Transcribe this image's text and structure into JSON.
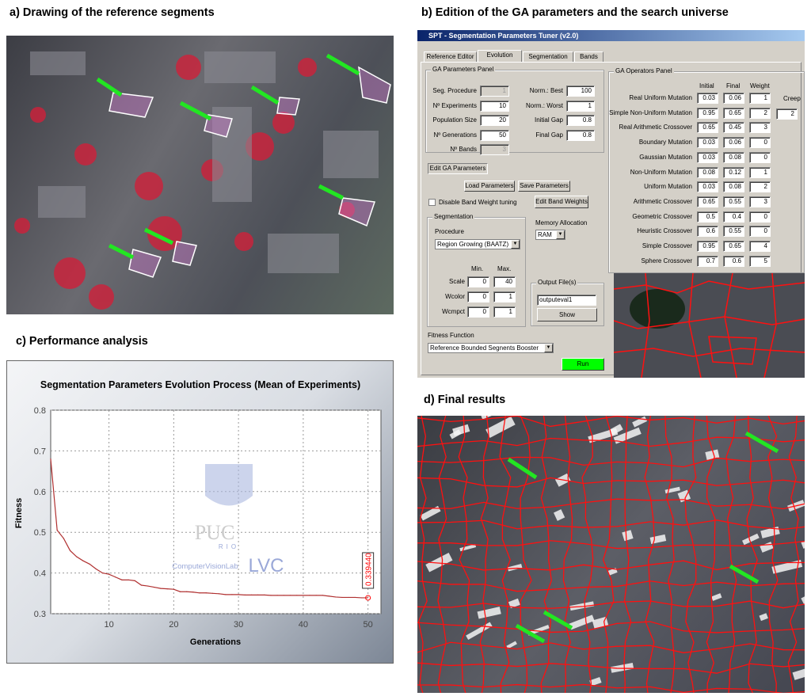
{
  "captions": {
    "a": "a) Drawing of the reference segments",
    "b": "b) Edition of the GA parameters and the search universe",
    "c": "c) Performance analysis",
    "d": "d) Final results"
  },
  "window": {
    "title": "SPT - Segmentation Parameters Tuner (v2.0)",
    "tabs": [
      "Reference Editor",
      "Evolution",
      "Segmentation",
      "Bands"
    ],
    "active_tab": "Evolution",
    "ga_params": {
      "title": "GA Parameters Panel",
      "left": [
        {
          "label": "Seg. Procedure",
          "value": "1",
          "disabled": true
        },
        {
          "label": "Nº Experiments",
          "value": "10"
        },
        {
          "label": "Population Size",
          "value": "20"
        },
        {
          "label": "Nº Generations",
          "value": "50"
        },
        {
          "label": "Nº Bands",
          "value": "3",
          "disabled": true
        }
      ],
      "right": [
        {
          "label": "Norm.: Best",
          "value": "100"
        },
        {
          "label": "Norm.: Worst",
          "value": "1"
        },
        {
          "label": "Initial Gap",
          "value": "0.8"
        },
        {
          "label": "Final Gap",
          "value": "0.8"
        }
      ]
    },
    "ga_ops": {
      "title": "GA Operators Panel",
      "headers": [
        "Initial",
        "Final",
        "Weight"
      ],
      "creep_label": "Creep",
      "creep_value": "2",
      "rows": [
        [
          "Real Uniform Mutation",
          "0.03",
          "0.06",
          "1"
        ],
        [
          "Simple Non-Uniform Mutation",
          "0.95",
          "0.65",
          "2"
        ],
        [
          "Real Arithmetic Crossover",
          "0.65",
          "0.45",
          "3"
        ],
        [
          "Boundary Mutation",
          "0.03",
          "0.06",
          "0"
        ],
        [
          "Gaussian Mutation",
          "0.03",
          "0.08",
          "0"
        ],
        [
          "Non-Uniform Mutation",
          "0.08",
          "0.12",
          "1"
        ],
        [
          "Uniform Mutation",
          "0.03",
          "0.08",
          "2"
        ],
        [
          "Arithmetic Crossover",
          "0.65",
          "0.55",
          "3"
        ],
        [
          "Geometric Crossover",
          "0.5",
          "0.4",
          "0"
        ],
        [
          "Heuristic Crossover",
          "0.6",
          "0.55",
          "0"
        ],
        [
          "Simple Crossover",
          "0.95",
          "0.65",
          "4"
        ],
        [
          "Sphere Crossover",
          "0.7",
          "0.6",
          "5"
        ]
      ]
    },
    "edit_ga": "Edit GA Parameters",
    "load": "Load Parameters",
    "save": "Save Parameters",
    "disable_band": "Disable Band Weight tuning",
    "edit_band": "Edit Band Weights",
    "segmentation": {
      "title": "Segmentation",
      "procedure_label": "Procedure",
      "procedure": "Region Growing (BAATZ)",
      "min": "Min.",
      "max": "Max.",
      "rows": [
        [
          "Scale",
          "0",
          "40"
        ],
        [
          "Wcolor",
          "0",
          "1"
        ],
        [
          "Wcmpct",
          "0",
          "1"
        ]
      ]
    },
    "memory_label": "Memory Allocation",
    "memory": "RAM",
    "output": {
      "title": "Output File(s)",
      "value": "outputeval1",
      "show": "Show"
    },
    "fitness_label": "Fitness Function",
    "fitness": "Reference Bounded Segnents Booster",
    "run": "Run",
    "run_color": "#00ff00"
  },
  "chart_data": {
    "type": "line",
    "title": "Segmentation Parameters Evolution Process (Mean of Experiments)",
    "xlabel": "Generations",
    "ylabel": "Fitness",
    "xlim": [
      1,
      52
    ],
    "ylim": [
      0.3,
      0.8
    ],
    "xticks": [
      10,
      20,
      30,
      40,
      50
    ],
    "yticks": [
      0.3,
      0.4,
      0.5,
      0.6,
      0.7,
      0.8
    ],
    "grid": true,
    "x": [
      1,
      2,
      3,
      4,
      5,
      6,
      7,
      8,
      9,
      10,
      11,
      12,
      13,
      14,
      15,
      16,
      17,
      18,
      19,
      20,
      21,
      22,
      23,
      24,
      25,
      26,
      27,
      28,
      29,
      30,
      31,
      32,
      33,
      34,
      35,
      36,
      37,
      38,
      39,
      40,
      41,
      42,
      43,
      44,
      45,
      46,
      47,
      48,
      49,
      50
    ],
    "y": [
      0.68,
      0.505,
      0.485,
      0.455,
      0.44,
      0.43,
      0.422,
      0.41,
      0.4,
      0.397,
      0.39,
      0.383,
      0.383,
      0.381,
      0.37,
      0.368,
      0.365,
      0.362,
      0.361,
      0.36,
      0.354,
      0.354,
      0.353,
      0.351,
      0.351,
      0.35,
      0.349,
      0.347,
      0.347,
      0.347,
      0.346,
      0.346,
      0.346,
      0.346,
      0.345,
      0.345,
      0.345,
      0.345,
      0.345,
      0.345,
      0.345,
      0.345,
      0.345,
      0.343,
      0.341,
      0.34,
      0.34,
      0.34,
      0.339,
      0.339
    ],
    "annotation": "0.339440",
    "line_color": "#b03030",
    "logo_text": [
      "PUC",
      "RIO",
      "ComputerVisionLab",
      "LVC"
    ]
  }
}
